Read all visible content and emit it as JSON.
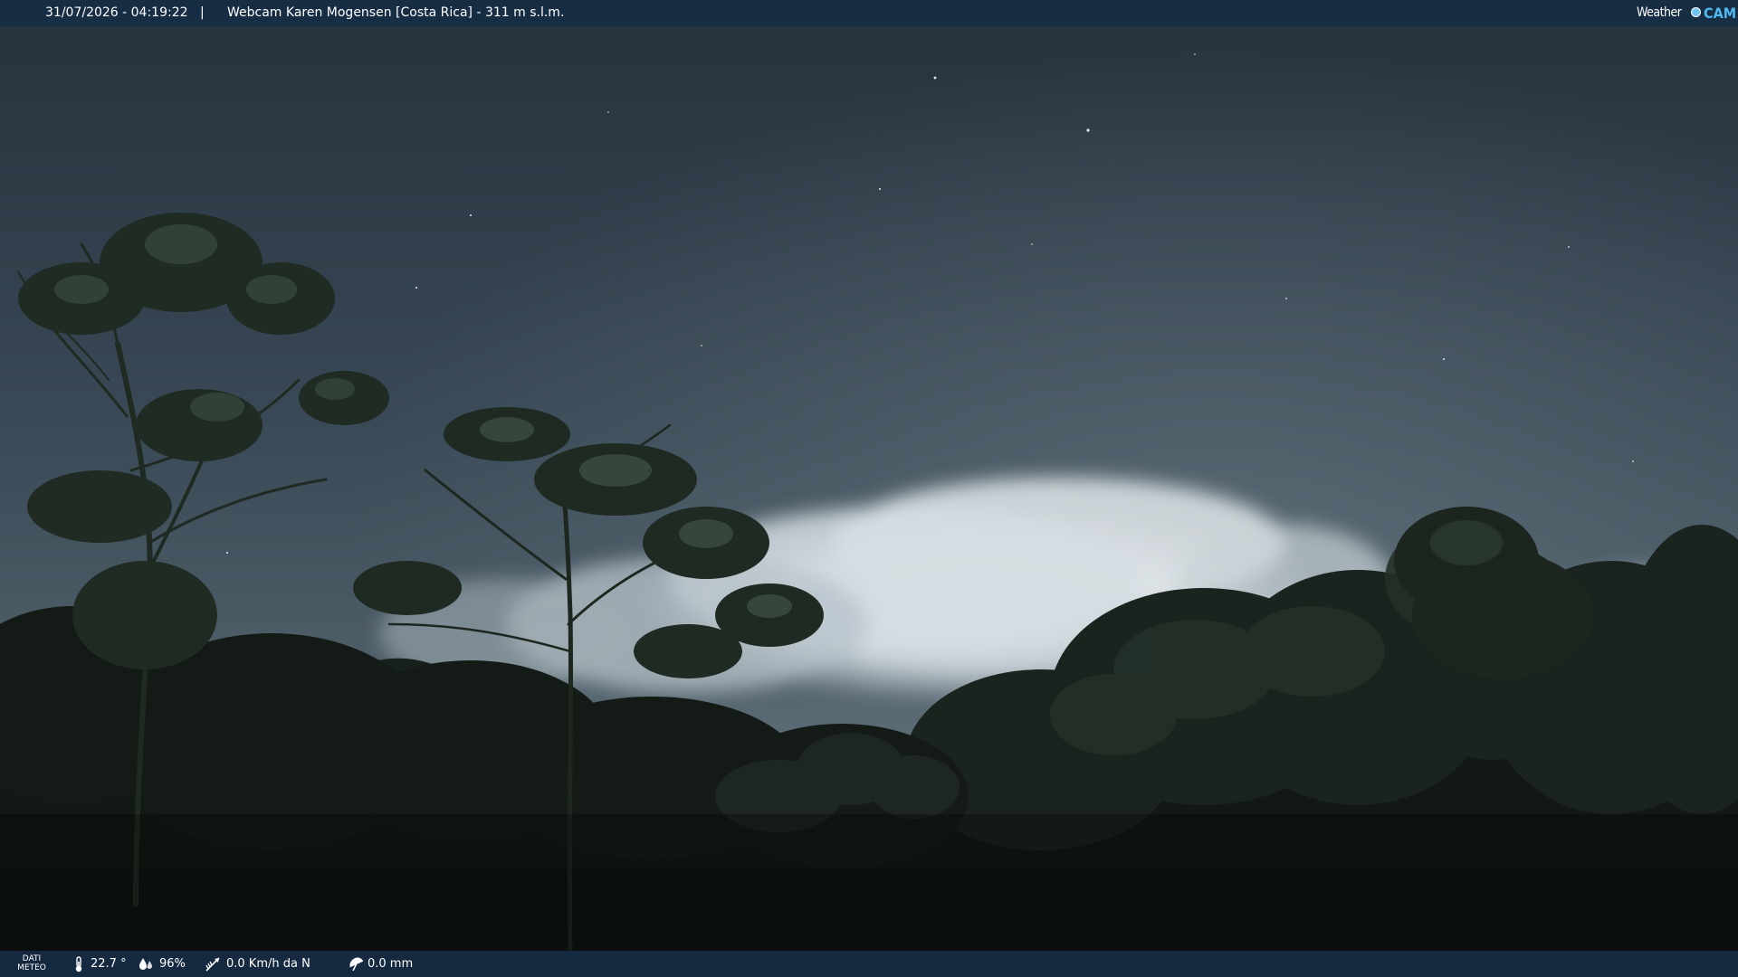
{
  "header": {
    "datetime": "31/07/2026 - 04:19:22",
    "separator": "|",
    "location": "Webcam Karen Mogensen [Costa Rica] - 311 m s.l.m."
  },
  "logo": {
    "weather": "Weather",
    "cam": "CAM"
  },
  "footer": {
    "meteo_label_line1": "DATI",
    "meteo_label_line2": "METEO",
    "temperature": "22.7 °",
    "humidity": "96%",
    "wind": "0.0 Km/h da N",
    "rain": "0.0 mm"
  },
  "icons": {
    "temperature": "thermometer-icon",
    "humidity": "humidity-drops-icon",
    "wind": "wind-vane-icon",
    "rain": "rain-umbrella-icon"
  },
  "colors": {
    "bar_background": "#162c46",
    "logo_accent": "#4fb8ee",
    "sky_top": "#2a3947",
    "sky_horizon": "#5c6d78"
  }
}
